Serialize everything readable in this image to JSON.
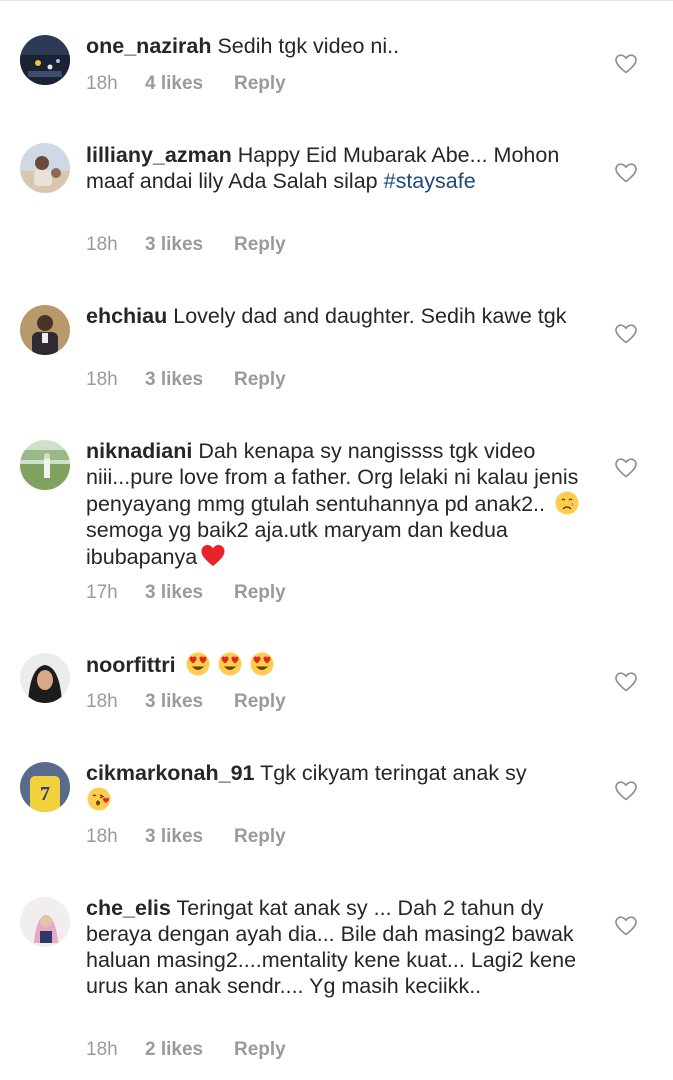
{
  "colors": {
    "text": "#262626",
    "meta": "#9a9a9a",
    "hashtag": "#1d4a7a",
    "heart_outline": "#8e8e8e"
  },
  "comments": [
    {
      "username": "one_nazirah",
      "text": "Sedih tgk video ni..",
      "time": "18h",
      "likes": "4 likes",
      "reply": "Reply"
    },
    {
      "username": "lilliany_azman",
      "text": "Happy Eid Mubarak Abe... Mohon maaf andai lily Ada Salah silap",
      "hashtag": "#staysafe",
      "time": "18h",
      "likes": "3 likes",
      "reply": "Reply"
    },
    {
      "username": "ehchiau",
      "text": "Lovely dad and daughter. Sedih kawe tgk",
      "time": "18h",
      "likes": "3 likes",
      "reply": "Reply"
    },
    {
      "username": "niknadiani",
      "text_part1": "Dah kenapa sy nangissss tgk video niii...pure love from a father. Org lelaki ni kalau jenis penyayang mmg gtulah sentuhannya pd anak2..",
      "text_part2": "semoga yg baik2 aja.utk maryam dan kedua ibubapanya",
      "emojis": [
        "crying-face-emoji",
        "red-heart-emoji"
      ],
      "time": "17h",
      "likes": "3 likes",
      "reply": "Reply"
    },
    {
      "username": "noorfittri",
      "text": "",
      "emojis": [
        "heart-eyes-emoji",
        "heart-eyes-emoji",
        "heart-eyes-emoji"
      ],
      "time": "18h",
      "likes": "3 likes",
      "reply": "Reply"
    },
    {
      "username": "cikmarkonah_91",
      "text": "Tgk cikyam teringat anak sy",
      "emojis": [
        "kissing-heart-emoji"
      ],
      "time": "18h",
      "likes": "3 likes",
      "reply": "Reply"
    },
    {
      "username": "che_elis",
      "text": "Teringat kat anak sy ... Dah 2 tahun dy beraya dengan ayah dia... Bile dah masing2 bawak haluan masing2....mentality kene kuat... Lagi2 kene urus kan anak sendr.... Yg masih keciikk..",
      "time": "18h",
      "likes": "2 likes",
      "reply": "Reply"
    }
  ],
  "icons": {
    "like": "heart-outline-icon"
  }
}
